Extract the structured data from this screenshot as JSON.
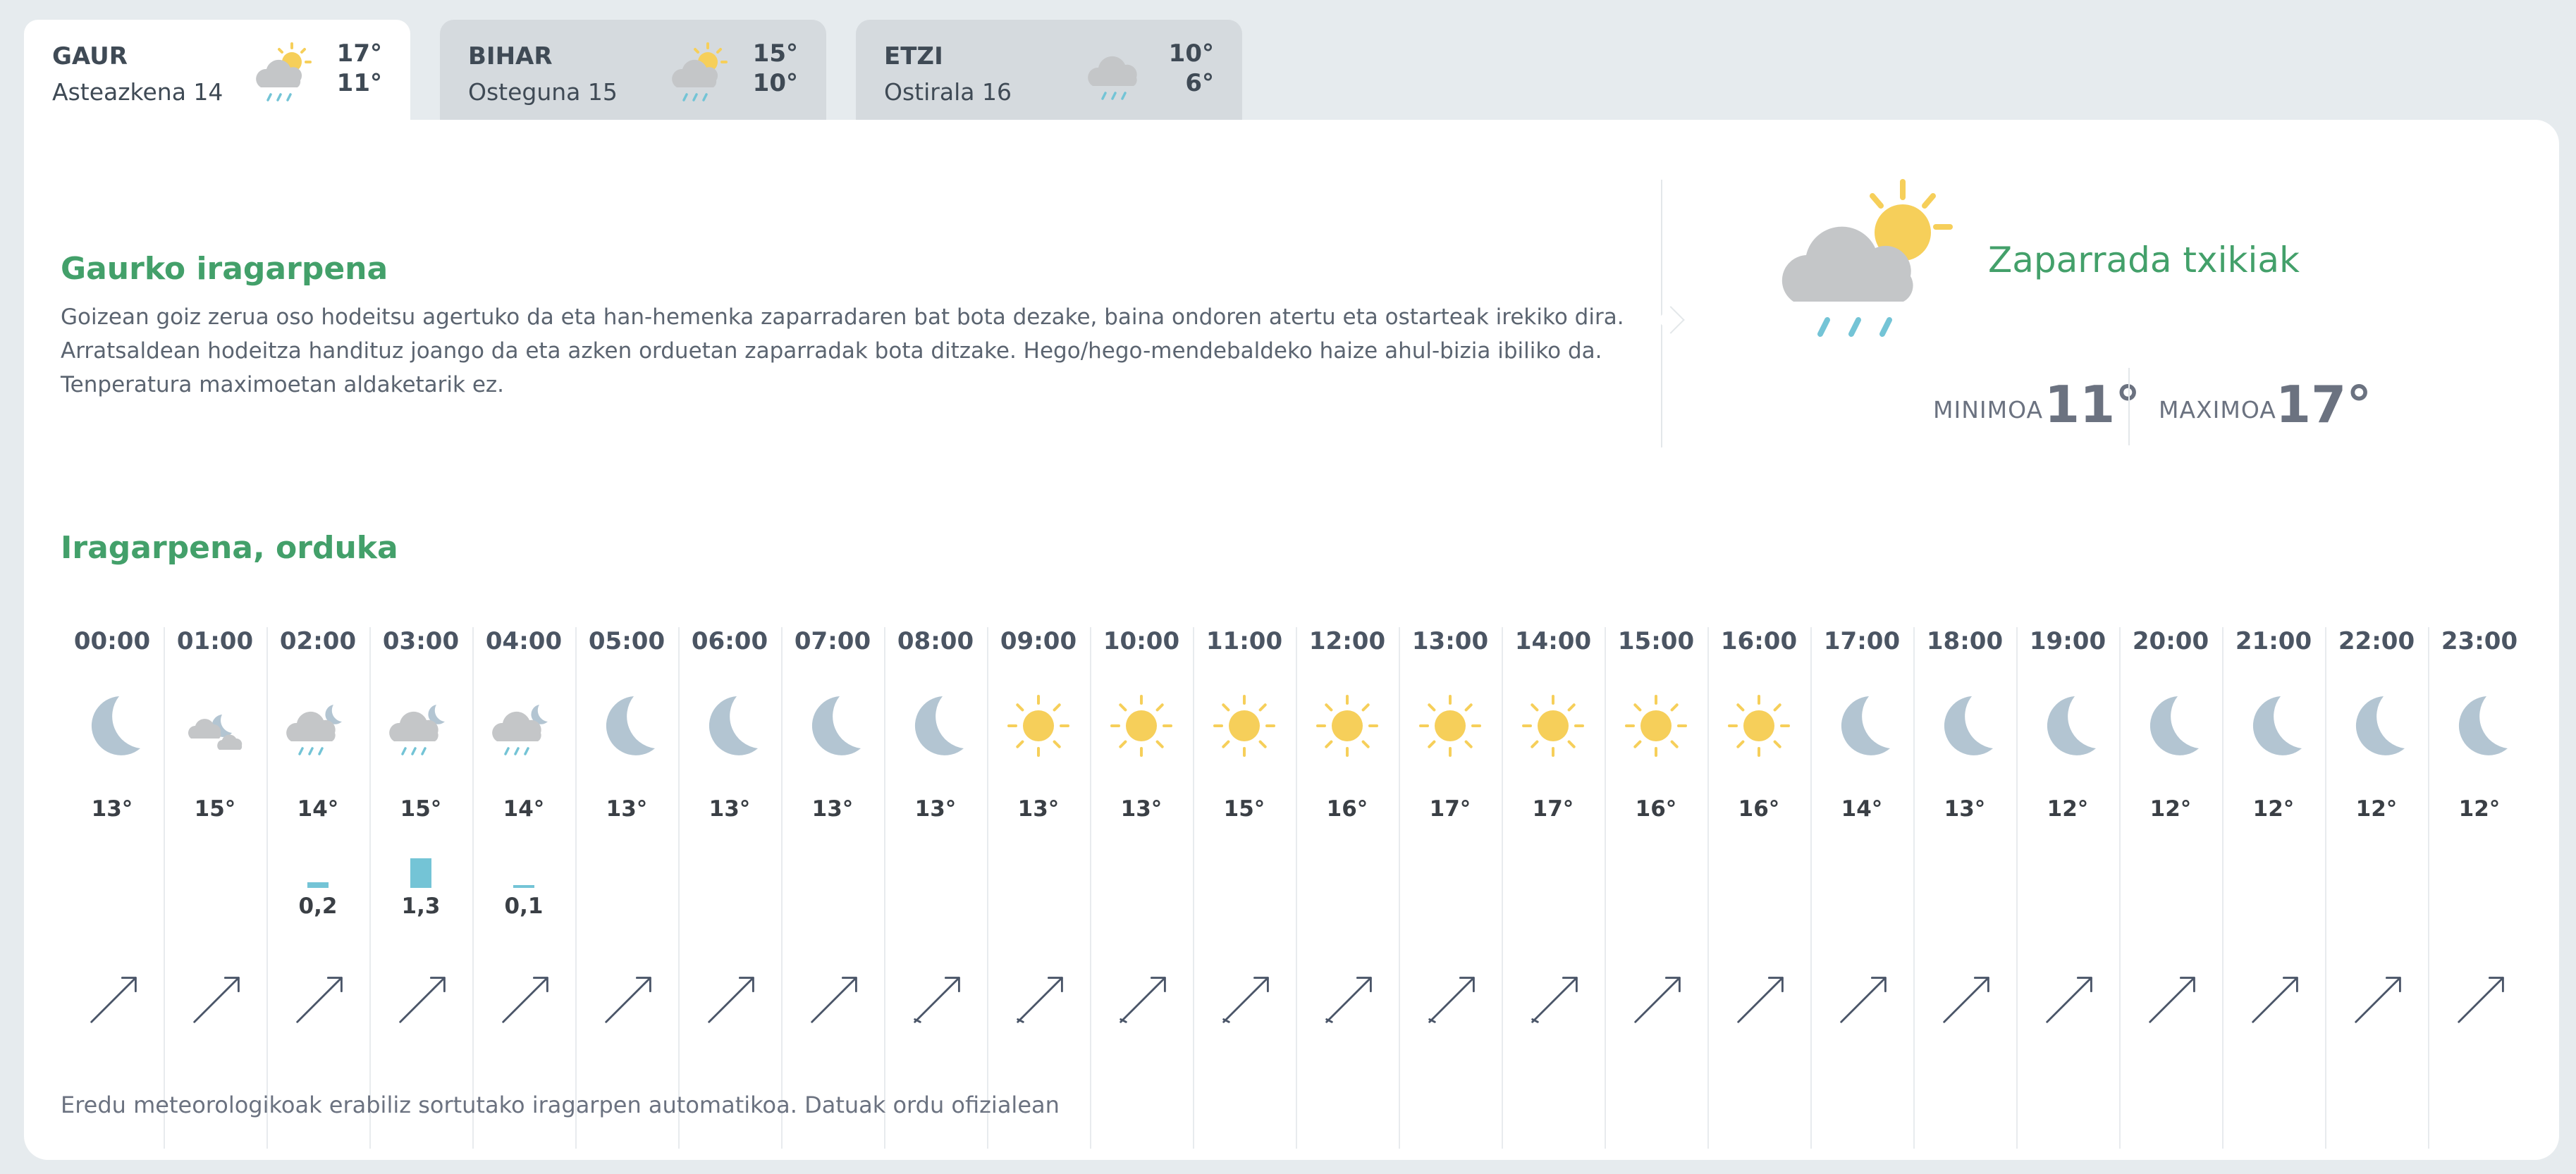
{
  "tabs": [
    {
      "name": "GAUR",
      "date": "Asteazkena 14",
      "max": "17°",
      "min": "11°",
      "icon": "sun-cloud-rain-icon",
      "active": true
    },
    {
      "name": "BIHAR",
      "date": "Osteguna 15",
      "max": "15°",
      "min": "10°",
      "icon": "sun-cloud-rain-icon",
      "active": false
    },
    {
      "name": "ETZI",
      "date": "Ostirala 16",
      "max": "10°",
      "min": "6°",
      "icon": "cloud-rain-icon",
      "active": false
    }
  ],
  "today": {
    "title": "Gaurko iragarpena",
    "text_lines": [
      "Goizean goiz zerua oso hodeitsu agertuko da eta han-hemenka zaparradaren bat bota dezake, baina ondoren atertu eta ostarteak irekiko dira.",
      "Arratsaldean hodeitza handituz joango da eta azken orduetan zaparradak bota ditzake. Hego/hego-mendebaldeko haize ahul-bizia ibiliko da.",
      "Tenperatura maximoetan aldaketarik ez."
    ],
    "summary": "Zaparrada txikiak",
    "icon": "sun-cloud-rain-icon",
    "min_label": "MINIMOA",
    "min_value": "11°",
    "max_label": "MAXIMOA",
    "max_value": "17°"
  },
  "hourly": {
    "title": "Iragarpena, orduka",
    "hours": [
      {
        "time": "00:00",
        "icon": "moon-icon",
        "temp": "13°",
        "precip": ""
      },
      {
        "time": "01:00",
        "icon": "moon-clouds-icon",
        "temp": "15°",
        "precip": ""
      },
      {
        "time": "02:00",
        "icon": "moon-cloud-rain-icon",
        "temp": "14°",
        "precip": "0,2"
      },
      {
        "time": "03:00",
        "icon": "moon-cloud-rain-icon",
        "temp": "15°",
        "precip": "1,3"
      },
      {
        "time": "04:00",
        "icon": "moon-cloud-rain-icon",
        "temp": "14°",
        "precip": "0,1"
      },
      {
        "time": "05:00",
        "icon": "moon-icon",
        "temp": "13°",
        "precip": ""
      },
      {
        "time": "06:00",
        "icon": "moon-icon",
        "temp": "13°",
        "precip": ""
      },
      {
        "time": "07:00",
        "icon": "moon-icon",
        "temp": "13°",
        "precip": ""
      },
      {
        "time": "08:00",
        "icon": "moon-icon",
        "temp": "13°",
        "precip": ""
      },
      {
        "time": "09:00",
        "icon": "sun-icon",
        "temp": "13°",
        "precip": ""
      },
      {
        "time": "10:00",
        "icon": "sun-icon",
        "temp": "13°",
        "precip": ""
      },
      {
        "time": "11:00",
        "icon": "sun-icon",
        "temp": "15°",
        "precip": ""
      },
      {
        "time": "12:00",
        "icon": "sun-icon",
        "temp": "16°",
        "precip": ""
      },
      {
        "time": "13:00",
        "icon": "sun-icon",
        "temp": "17°",
        "precip": ""
      },
      {
        "time": "14:00",
        "icon": "sun-icon",
        "temp": "17°",
        "precip": ""
      },
      {
        "time": "15:00",
        "icon": "sun-icon",
        "temp": "16°",
        "precip": ""
      },
      {
        "time": "16:00",
        "icon": "sun-icon",
        "temp": "16°",
        "precip": ""
      },
      {
        "time": "17:00",
        "icon": "moon-icon",
        "temp": "14°",
        "precip": ""
      },
      {
        "time": "18:00",
        "icon": "moon-icon",
        "temp": "13°",
        "precip": ""
      },
      {
        "time": "19:00",
        "icon": "moon-icon",
        "temp": "12°",
        "precip": ""
      },
      {
        "time": "20:00",
        "icon": "moon-icon",
        "temp": "12°",
        "precip": ""
      },
      {
        "time": "21:00",
        "icon": "moon-icon",
        "temp": "12°",
        "precip": ""
      },
      {
        "time": "22:00",
        "icon": "moon-icon",
        "temp": "12°",
        "precip": ""
      },
      {
        "time": "23:00",
        "icon": "moon-icon",
        "temp": "12°",
        "precip": ""
      }
    ]
  },
  "footer": "Eredu meteorologikoak erabiliz sortutako iragarpen automatikoa. Datuak ordu ofizialean",
  "colors": {
    "accent": "#43a06a",
    "sun": "#f6cf5a",
    "moon": "#b3c5d2",
    "cloud": "#c4c6c8",
    "rain": "#74c4d6",
    "wind": "#4a5568"
  }
}
